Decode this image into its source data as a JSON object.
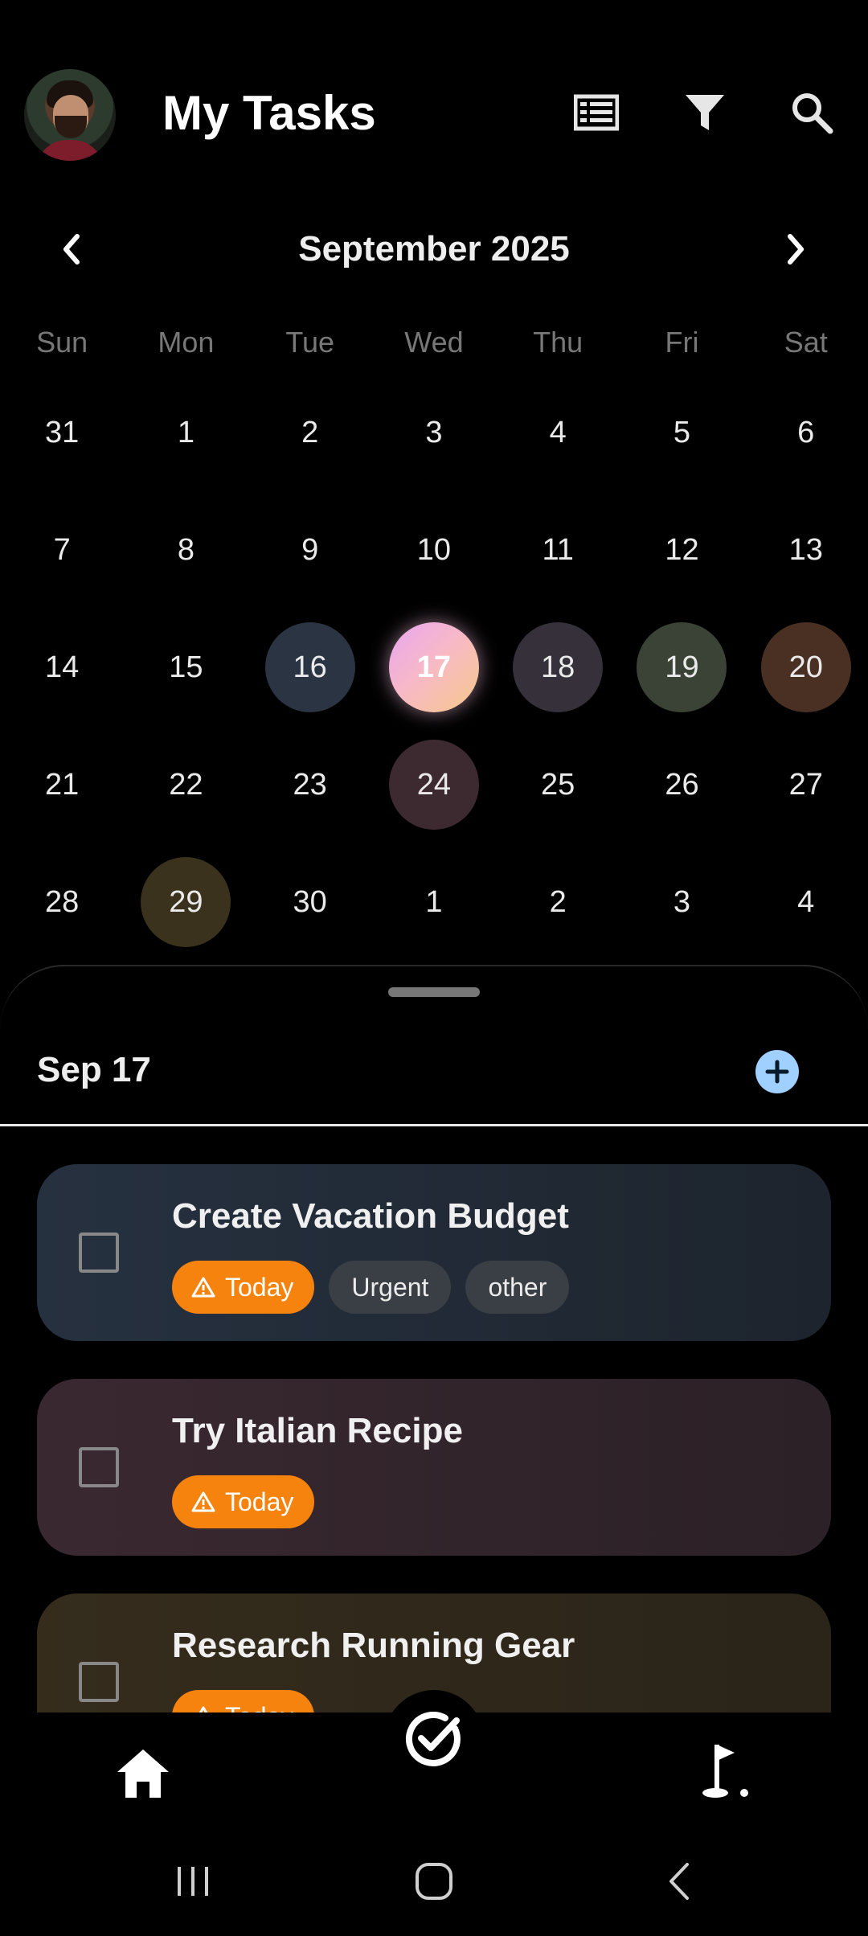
{
  "header": {
    "title": "My Tasks",
    "icons": [
      "list-view-icon",
      "filter-icon",
      "search-icon"
    ]
  },
  "calendar": {
    "month_label": "September 2025",
    "weekdays": [
      "Sun",
      "Mon",
      "Tue",
      "Wed",
      "Thu",
      "Fri",
      "Sat"
    ],
    "weeks": [
      [
        "31",
        "1",
        "2",
        "3",
        "4",
        "5",
        "6"
      ],
      [
        "7",
        "8",
        "9",
        "10",
        "11",
        "12",
        "13"
      ],
      [
        "14",
        "15",
        "16",
        "17",
        "18",
        "19",
        "20"
      ],
      [
        "21",
        "22",
        "23",
        "24",
        "25",
        "26",
        "27"
      ],
      [
        "28",
        "29",
        "30",
        "1",
        "2",
        "3",
        "4"
      ]
    ],
    "selected_day": "17"
  },
  "sheet": {
    "date_label": "Sep 17",
    "tasks": [
      {
        "name": "Create Vacation Budget",
        "due_label": "Today",
        "tags": [
          "Urgent",
          "other"
        ],
        "color": "#222b36"
      },
      {
        "name": "Try Italian Recipe",
        "due_label": "Today",
        "tags": [],
        "color": "#33242a"
      },
      {
        "name": "Research Running Gear",
        "due_label": "Today",
        "tags": [],
        "color": "#2d2718"
      }
    ]
  },
  "colors": {
    "accent": "#9fd0ff",
    "today_chip": "#f7830f",
    "background": "#000000"
  },
  "bottom_nav": {
    "items": [
      "home-icon",
      "task-check-icon",
      "golf-flag-icon"
    ]
  }
}
